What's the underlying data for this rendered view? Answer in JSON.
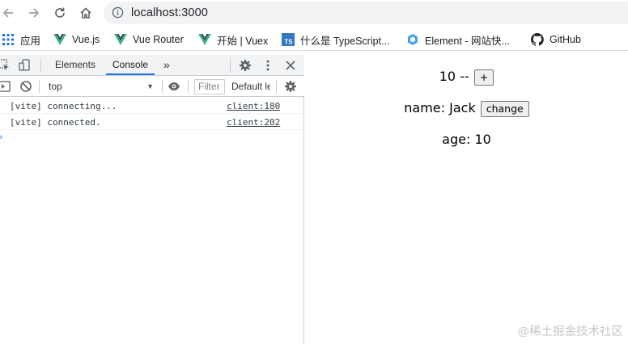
{
  "browser": {
    "url": "localhost:3000",
    "bookmarks": [
      {
        "label": "应用",
        "icon": "apps-grid-icon"
      },
      {
        "label": "Vue.js",
        "icon": "vue-logo-icon"
      },
      {
        "label": "Vue Router",
        "icon": "vue-logo-icon"
      },
      {
        "label": "开始 | Vuex",
        "icon": "vue-logo-icon"
      },
      {
        "label": "什么是 TypeScript...",
        "icon": "typescript-logo-icon"
      },
      {
        "label": "Element - 网站快...",
        "icon": "element-logo-icon"
      },
      {
        "label": "GitHub",
        "icon": "github-logo-icon"
      }
    ]
  },
  "devtools": {
    "tabs": {
      "elements": "Elements",
      "console": "Console",
      "more": "»"
    },
    "console_bar": {
      "context": "top",
      "filter_placeholder": "Filter",
      "levels": "Default levels"
    },
    "logs": [
      {
        "message": "[vite] connecting...",
        "source": "client:180"
      },
      {
        "message": "[vite] connected.",
        "source": "client:202"
      }
    ],
    "prompt": "›"
  },
  "page": {
    "counter_text": "10 --",
    "increment_label": "+",
    "name_text": "name: Jack",
    "change_label": "change",
    "age_text": "age: 10"
  },
  "watermark": "@稀土掘金技术社区",
  "colors": {
    "accent": "#1a73e8",
    "vue_green": "#41b883",
    "ts_blue": "#3178c6"
  }
}
